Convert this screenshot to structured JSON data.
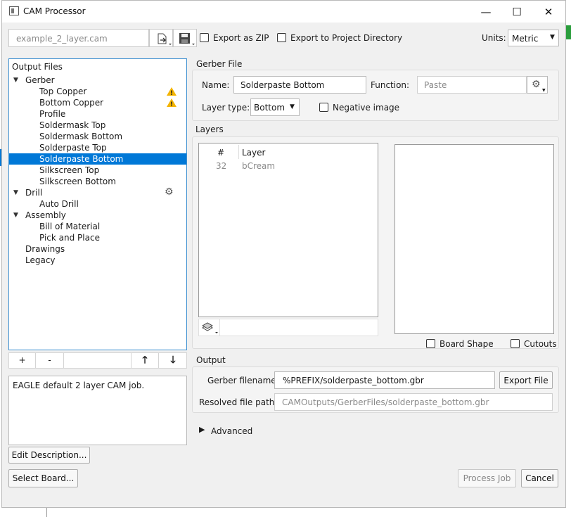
{
  "window": {
    "title": "CAM Processor",
    "minimize": "—",
    "maximize": "☐",
    "close": "✕"
  },
  "toolbar": {
    "job_file": "example_2_layer.cam",
    "export_zip_label": "Export as ZIP",
    "export_project_label": "Export to Project Directory",
    "units_label": "Units:",
    "units_value": "Metric"
  },
  "output_files": {
    "heading": "Output Files",
    "items": [
      {
        "label": "Gerber",
        "expanded": true
      },
      {
        "label": "Top Copper",
        "warning": true
      },
      {
        "label": "Bottom Copper",
        "warning": true
      },
      {
        "label": "Profile"
      },
      {
        "label": "Soldermask Top"
      },
      {
        "label": "Soldermask Bottom"
      },
      {
        "label": "Solderpaste Top"
      },
      {
        "label": "Solderpaste Bottom",
        "selected": true
      },
      {
        "label": "Silkscreen Top"
      },
      {
        "label": "Silkscreen Bottom"
      },
      {
        "label": "Drill",
        "expanded": true,
        "gear": true
      },
      {
        "label": "Auto Drill"
      },
      {
        "label": "Assembly",
        "expanded": true
      },
      {
        "label": "Bill of Material"
      },
      {
        "label": "Pick and Place"
      },
      {
        "label": "Drawings"
      },
      {
        "label": "Legacy"
      }
    ],
    "add_label": "+",
    "remove_label": "-"
  },
  "description": {
    "text": "EAGLE default 2 layer CAM job.",
    "edit_button": "Edit Description...",
    "select_board_button": "Select Board..."
  },
  "gerber_file": {
    "section_title": "Gerber File",
    "name_label": "Name:",
    "name_value": "Solderpaste Bottom",
    "function_label": "Function:",
    "function_value": "Paste",
    "layer_type_label": "Layer type:",
    "layer_type_value": "Bottom",
    "negative_label": "Negative image"
  },
  "layers": {
    "section_title": "Layers",
    "col_num": "#",
    "col_layer": "Layer",
    "rows": [
      {
        "num": "32",
        "name": "bCream"
      }
    ],
    "board_shape_label": "Board Shape",
    "cutouts_label": "Cutouts"
  },
  "output": {
    "section_title": "Output",
    "gerber_filename_label": "Gerber filename:",
    "gerber_filename_value": "%PREFIX/solderpaste_bottom.gbr",
    "export_file_button": "Export File",
    "resolved_label": "Resolved file path:",
    "resolved_value": "CAMOutputs/GerberFiles/solderpaste_bottom.gbr"
  },
  "advanced_label": "Advanced",
  "footer": {
    "process_button": "Process Job",
    "cancel_button": "Cancel"
  }
}
